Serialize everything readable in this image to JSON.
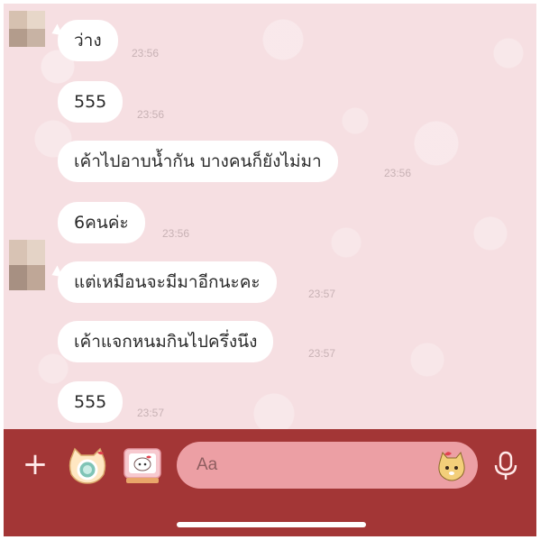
{
  "chat": {
    "messages": [
      {
        "text": "ว่าง",
        "time": "23:56"
      },
      {
        "text": "555",
        "time": "23:56"
      },
      {
        "text": "เค้าไปอาบน้ำกัน  บางคนก็ยังไม่มา",
        "time": "23:56"
      },
      {
        "text": "6คนค่ะ",
        "time": "23:56"
      },
      {
        "text": "แต่เหมือนจะมีมาอีกนะคะ",
        "time": "23:57"
      },
      {
        "text": "เค้าแจกหนมกินไปครึ่งนึง",
        "time": "23:57"
      },
      {
        "text": "555",
        "time": "23:57"
      }
    ]
  },
  "input_bar": {
    "placeholder": "Aa",
    "plus_label": "+",
    "background_color": "#a33636",
    "field_color": "#ec9fa4"
  },
  "icons": {
    "plus": "plus-icon",
    "camera": "camera-icon",
    "photo": "photo-icon",
    "sticker": "sticker-icon",
    "mic": "microphone-icon"
  },
  "colors": {
    "wallpaper": "#f6dfe2",
    "bubble": "#ffffff",
    "timestamp": "#c8b2b5"
  }
}
